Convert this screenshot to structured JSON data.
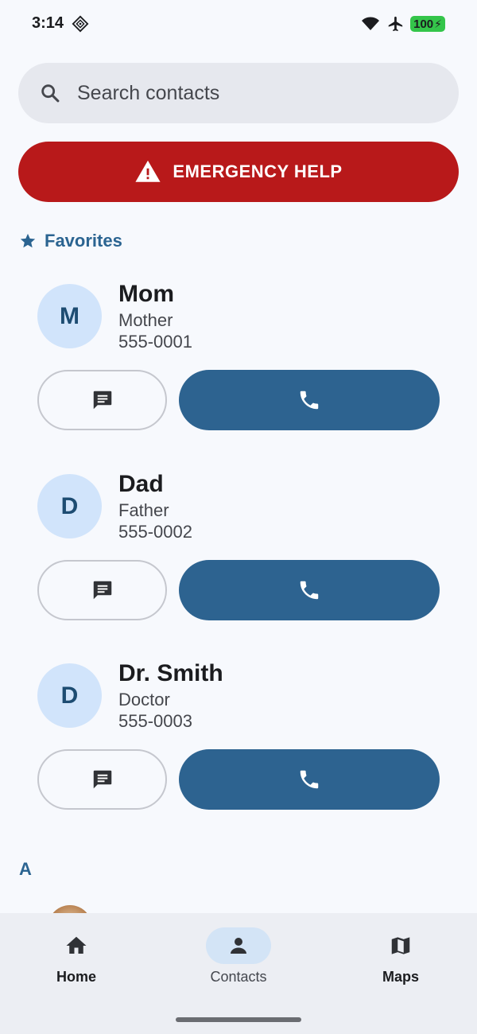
{
  "status_bar": {
    "time": "3:14",
    "battery": "100",
    "icons": [
      "data-saver-icon",
      "wifi-icon",
      "airplane-icon",
      "battery-charging-icon"
    ]
  },
  "search": {
    "placeholder": "Search contacts"
  },
  "emergency": {
    "label": "EMERGENCY HELP",
    "color": "#b8191a"
  },
  "favorites": {
    "heading": "Favorites",
    "contacts": [
      {
        "initial": "M",
        "name": "Mom",
        "relation": "Mother",
        "phone": "555-0001"
      },
      {
        "initial": "D",
        "name": "Dad",
        "relation": "Father",
        "phone": "555-0002"
      },
      {
        "initial": "D",
        "name": "Dr. Smith",
        "relation": "Doctor",
        "phone": "555-0003"
      }
    ]
  },
  "section": {
    "letter": "A"
  },
  "bottom_nav": {
    "items": [
      {
        "label": "Home",
        "icon": "home-icon",
        "active": false
      },
      {
        "label": "Contacts",
        "icon": "person-icon",
        "active": true
      },
      {
        "label": "Maps",
        "icon": "map-icon",
        "active": false
      }
    ]
  },
  "colors": {
    "accent": "#2d6390",
    "heading": "#2b6491",
    "avatar_bg": "#d1e4fb",
    "emergency": "#b8191a"
  }
}
